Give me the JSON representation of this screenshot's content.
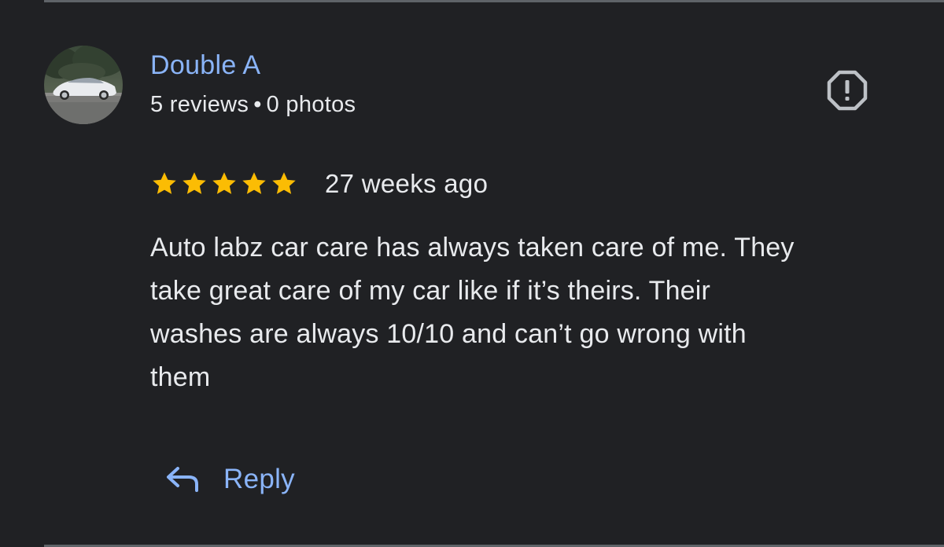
{
  "review": {
    "author": {
      "name": "Double A",
      "reviews_count": "5 reviews",
      "separator": "•",
      "photos_count": "0 photos",
      "avatar_icon": "car-photo-avatar"
    },
    "rating": {
      "stars": 5,
      "max_stars": 5,
      "star_color": "#fbbc04"
    },
    "date": "27 weeks ago",
    "text_lines": [
      "Auto labz car care has always taken care of me. They",
      "take great care of my car like if it’s theirs. Their",
      "washes are always 10/10 and can’t go wrong with",
      "them"
    ],
    "actions": {
      "report_icon": "report-octagon-icon",
      "reply_icon": "reply-arrow-icon",
      "reply_label": "Reply"
    }
  },
  "theme": {
    "background": "#202124",
    "link_color": "#8ab4f8",
    "text_color": "#e8eaed",
    "divider_color": "#5f6368"
  }
}
